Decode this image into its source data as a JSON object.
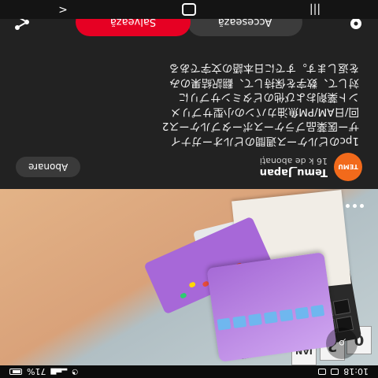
{
  "status_bar": {
    "time": "10:18",
    "battery": "71%"
  },
  "photo": {
    "calendar_cards": [
      "0",
      "2",
      "JAN"
    ],
    "dots": 3
  },
  "seller": {
    "logo_text": "TEMU",
    "name": "Temu_Japan",
    "followers": "16 k de abonați",
    "subscribe_label": "Abonare"
  },
  "description": [
    "1pcのピルケース週間のピルオーガナイ",
    "ザー医薬品ブラケースポータブルケース2",
    "回/日AM/PM魚油カバンの小型サプリメ",
    "ント薬剤および他のビタミンサプリに",
    "対して、数字を保持して、翻訳結果のみ",
    "を返します。すでに日本語の文字である"
  ],
  "actions": {
    "access_label": "Accesează",
    "save_label": "Salvează"
  },
  "icons": {
    "share": "share-icon",
    "pin": "pin-icon",
    "lens": "visual-search-icon",
    "back": "back-icon",
    "home": "home-icon",
    "recents": "recents-icon"
  },
  "colors": {
    "save": "#e60023",
    "secondary_button": "#3c3c3c",
    "background": "#222222",
    "temu_logo": "#f26a1b"
  }
}
